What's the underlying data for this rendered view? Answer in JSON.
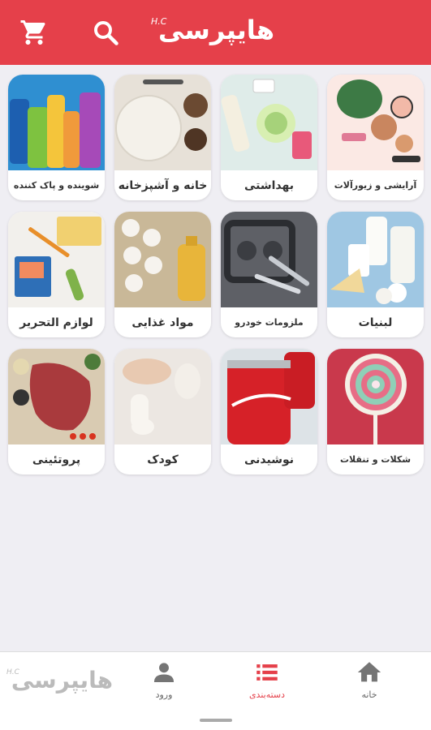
{
  "header": {
    "logo_text": "هایپرسی",
    "logo_mark": "H.C",
    "cart_icon": "cart-icon",
    "search_icon": "search-icon",
    "background_color": "#e5404a"
  },
  "categories": [
    {
      "label": "آرایشی و زیورآلات",
      "image": "cosmetics"
    },
    {
      "label": "بهداشتی",
      "image": "hygiene"
    },
    {
      "label": "خانه و آشپزخانه",
      "image": "kitchen"
    },
    {
      "label": "شوینده و پاک کننده",
      "image": "detergents"
    },
    {
      "label": "لبنیات",
      "image": "dairy"
    },
    {
      "label": "ملزومات خودرو",
      "image": "car-parts"
    },
    {
      "label": "مواد غذایی",
      "image": "groceries"
    },
    {
      "label": "لوازم التحریر",
      "image": "stationery"
    },
    {
      "label": "شکلات و تنقلات",
      "image": "candy"
    },
    {
      "label": "نوشیدنی",
      "image": "drinks"
    },
    {
      "label": "کودک",
      "image": "baby"
    },
    {
      "label": "پروتئینی",
      "image": "protein"
    }
  ],
  "bottom_nav": {
    "home_label": "خانه",
    "categories_label": "دسته‌بندی",
    "login_label": "ورود",
    "logo_text": "هایپرسی",
    "logo_mark": "H.C",
    "active_color": "#e5404a"
  }
}
